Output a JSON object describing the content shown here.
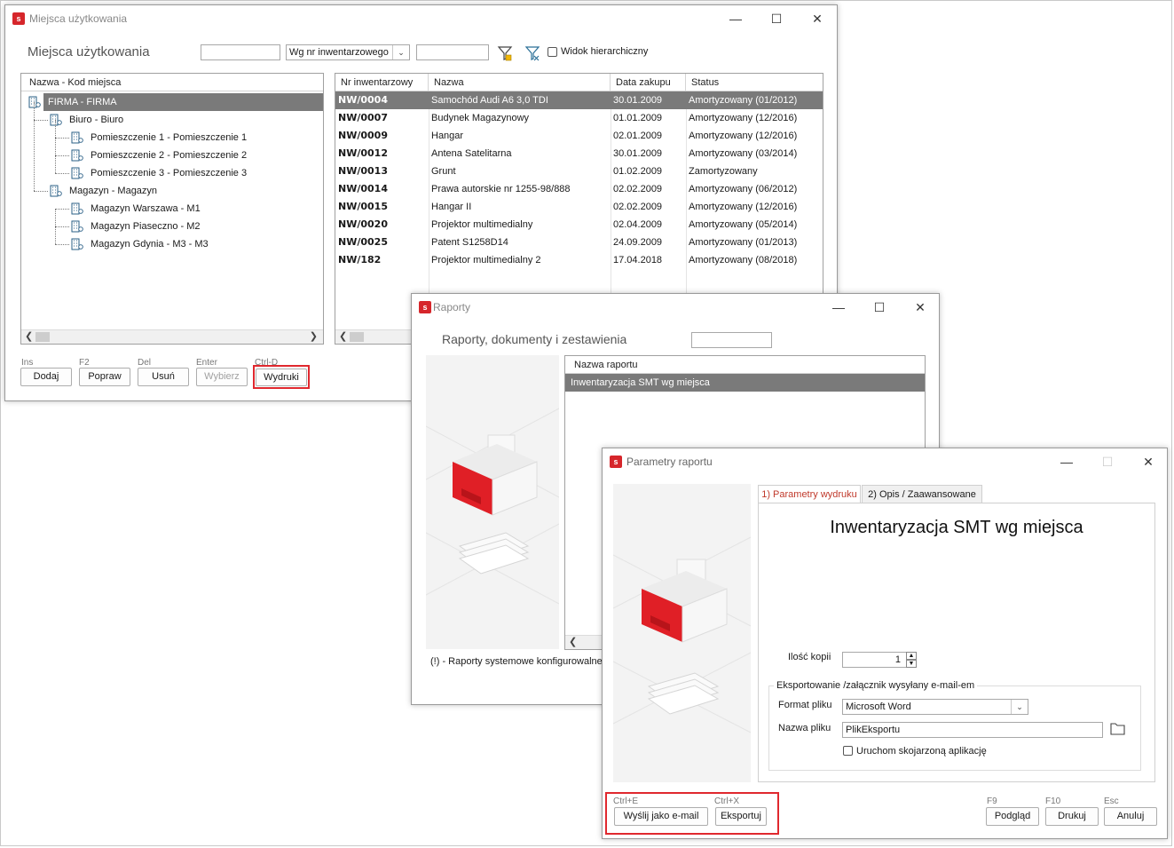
{
  "main_window": {
    "title": "Miejsca użytkowania",
    "heading": "Miejsca użytkowania",
    "filter_text": "",
    "sort_select": "Wg nr inwentarzowego",
    "filter_value": "",
    "hierarchical_label": "Widok hierarchiczny",
    "tree_header": "Nazwa - Kod miejsca",
    "tree": [
      {
        "label": "FIRMA - FIRMA",
        "level": 0,
        "selected": true
      },
      {
        "label": "Biuro - Biuro",
        "level": 1
      },
      {
        "label": "Pomieszczenie 1 - Pomieszczenie 1",
        "level": 2
      },
      {
        "label": "Pomieszczenie 2 - Pomieszczenie 2",
        "level": 2
      },
      {
        "label": "Pomieszczenie 3 - Pomieszczenie 3",
        "level": 2
      },
      {
        "label": "Magazyn - Magazyn",
        "level": 1
      },
      {
        "label": "Magazyn Warszawa - M1",
        "level": 2
      },
      {
        "label": "Magazyn Piaseczno - M2",
        "level": 2
      },
      {
        "label": "Magazyn Gdynia - M3 - M3",
        "level": 2
      }
    ],
    "columns": [
      "Nr inwentarzowy",
      "Nazwa",
      "Data zakupu",
      "Status"
    ],
    "rows": [
      [
        "NW/0004",
        "Samochód Audi A6 3,0 TDI",
        "30.01.2009",
        "Amortyzowany (01/2012)"
      ],
      [
        "NW/0007",
        "Budynek Magazynowy",
        "01.01.2009",
        "Amortyzowany (12/2016)"
      ],
      [
        "NW/0009",
        "Hangar",
        "02.01.2009",
        "Amortyzowany (12/2016)"
      ],
      [
        "NW/0012",
        "Antena Satelitarna",
        "30.01.2009",
        "Amortyzowany (03/2014)"
      ],
      [
        "NW/0013",
        "Grunt",
        "01.02.2009",
        "Zamortyzowany"
      ],
      [
        "NW/0014",
        "Prawa autorskie nr 1255-98/888",
        "02.02.2009",
        "Amortyzowany (06/2012)"
      ],
      [
        "NW/0015",
        "Hangar II",
        "02.02.2009",
        "Amortyzowany (12/2016)"
      ],
      [
        "NW/0020",
        "Projektor multimedialny",
        "02.04.2009",
        "Amortyzowany (05/2014)"
      ],
      [
        "NW/0025",
        "Patent S1258D14",
        "24.09.2009",
        "Amortyzowany (01/2013)"
      ],
      [
        "NW/182",
        "Projektor multimedialny 2",
        "17.04.2018",
        "Amortyzowany (08/2018)"
      ]
    ],
    "buttons": [
      {
        "key": "Ins",
        "label": "Dodaj"
      },
      {
        "key": "F2",
        "label": "Popraw"
      },
      {
        "key": "Del",
        "label": "Usuń"
      },
      {
        "key": "Enter",
        "label": "Wybierz"
      },
      {
        "key": "Ctrl-D",
        "label": "Wydruki"
      }
    ]
  },
  "reports_window": {
    "title": "Raporty",
    "heading": "Raporty, dokumenty i zestawienia",
    "search": "",
    "column": "Nazwa raportu",
    "items": [
      "Inwentaryzacja SMT wg miejsca"
    ],
    "footnote": "(!) - Raporty systemowe konfigurowalne"
  },
  "params_window": {
    "title": "Parametry raportu",
    "tab1": "1) Parametry wydruku",
    "tab2": "2) Opis / Zaawansowane",
    "report_title": "Inwentaryzacja SMT wg miejsca",
    "copies_label": "Ilość kopii",
    "copies_value": "1",
    "export_group": "Eksportowanie /załącznik wysyłany e-mail-em",
    "format_label": "Format pliku",
    "format_value": "Microsoft Word",
    "filename_label": "Nazwa pliku",
    "filename_value": "PlikEksportu",
    "open_app_label": "Uruchom skojarzoną aplikację",
    "left_buttons": [
      {
        "key": "Ctrl+E",
        "label": "Wyślij jako e-mail"
      },
      {
        "key": "Ctrl+X",
        "label": "Eksportuj"
      }
    ],
    "right_buttons": [
      {
        "key": "F9",
        "label": "Podgląd"
      },
      {
        "key": "F10",
        "label": "Drukuj"
      },
      {
        "key": "Esc",
        "label": "Anuluj"
      }
    ]
  },
  "icons": {
    "minimize": "minimize-icon",
    "maximize": "maximize-icon",
    "close": "close-icon",
    "folder": "folder-icon",
    "filter": "filter-icon"
  }
}
